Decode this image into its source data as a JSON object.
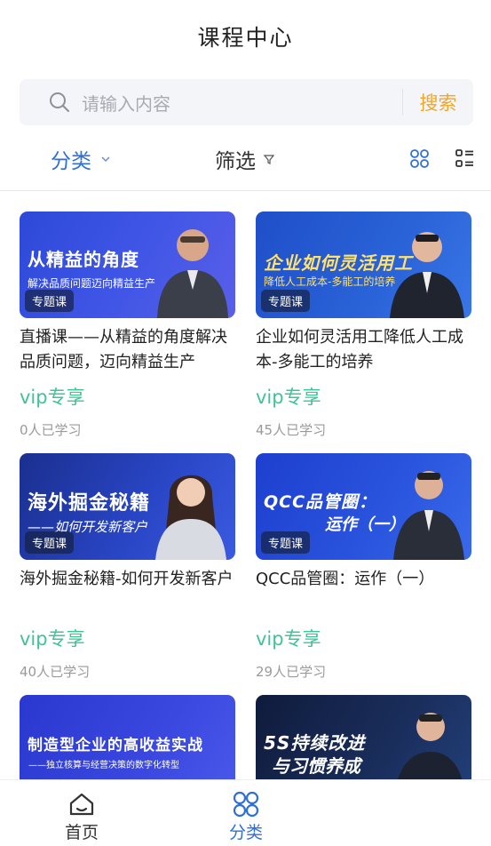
{
  "header": {
    "title": "课程中心"
  },
  "search": {
    "placeholder": "请输入内容",
    "button": "搜索"
  },
  "filters": {
    "category": "分类",
    "filter": "筛选"
  },
  "courses": [
    {
      "thumb_title": "从精益的角度",
      "thumb_subtitle": "解决品质问题迈向精益生产",
      "badge": "专题课",
      "title": "直播课——从精益的角度解决品质问题，迈向精益生产",
      "vip": "vip专享",
      "learners": "0人已学习"
    },
    {
      "thumb_title": "企业如何灵活用工",
      "thumb_subtitle": "降低人工成本-多能工的培养",
      "badge": "专题课",
      "title": "企业如何灵活用工降低人工成本-多能工的培养",
      "vip": "vip专享",
      "learners": "45人已学习"
    },
    {
      "thumb_title": "海外掘金秘籍",
      "thumb_subtitle": "——如何开发新客户",
      "badge": "专题课",
      "title": "海外掘金秘籍-如何开发新客户",
      "vip": "vip专享",
      "learners": "40人已学习"
    },
    {
      "thumb_title": "QCC品管圈：",
      "thumb_subtitle": "运作（一）",
      "badge": "专题课",
      "title": "QCC品管圈：运作（一）",
      "vip": "vip专享",
      "learners": "29人已学习"
    },
    {
      "thumb_title": "制造型企业的高收益实战",
      "thumb_subtitle": "——独立核算与经营决策的数字化转型"
    },
    {
      "thumb_title": "5S持续改进",
      "thumb_subtitle": "与习惯养成"
    }
  ],
  "tabbar": {
    "home": "首页",
    "category": "分类"
  },
  "colors": {
    "accent": "#2f6fd6",
    "search_button": "#f5a623",
    "vip": "#3ec495"
  }
}
